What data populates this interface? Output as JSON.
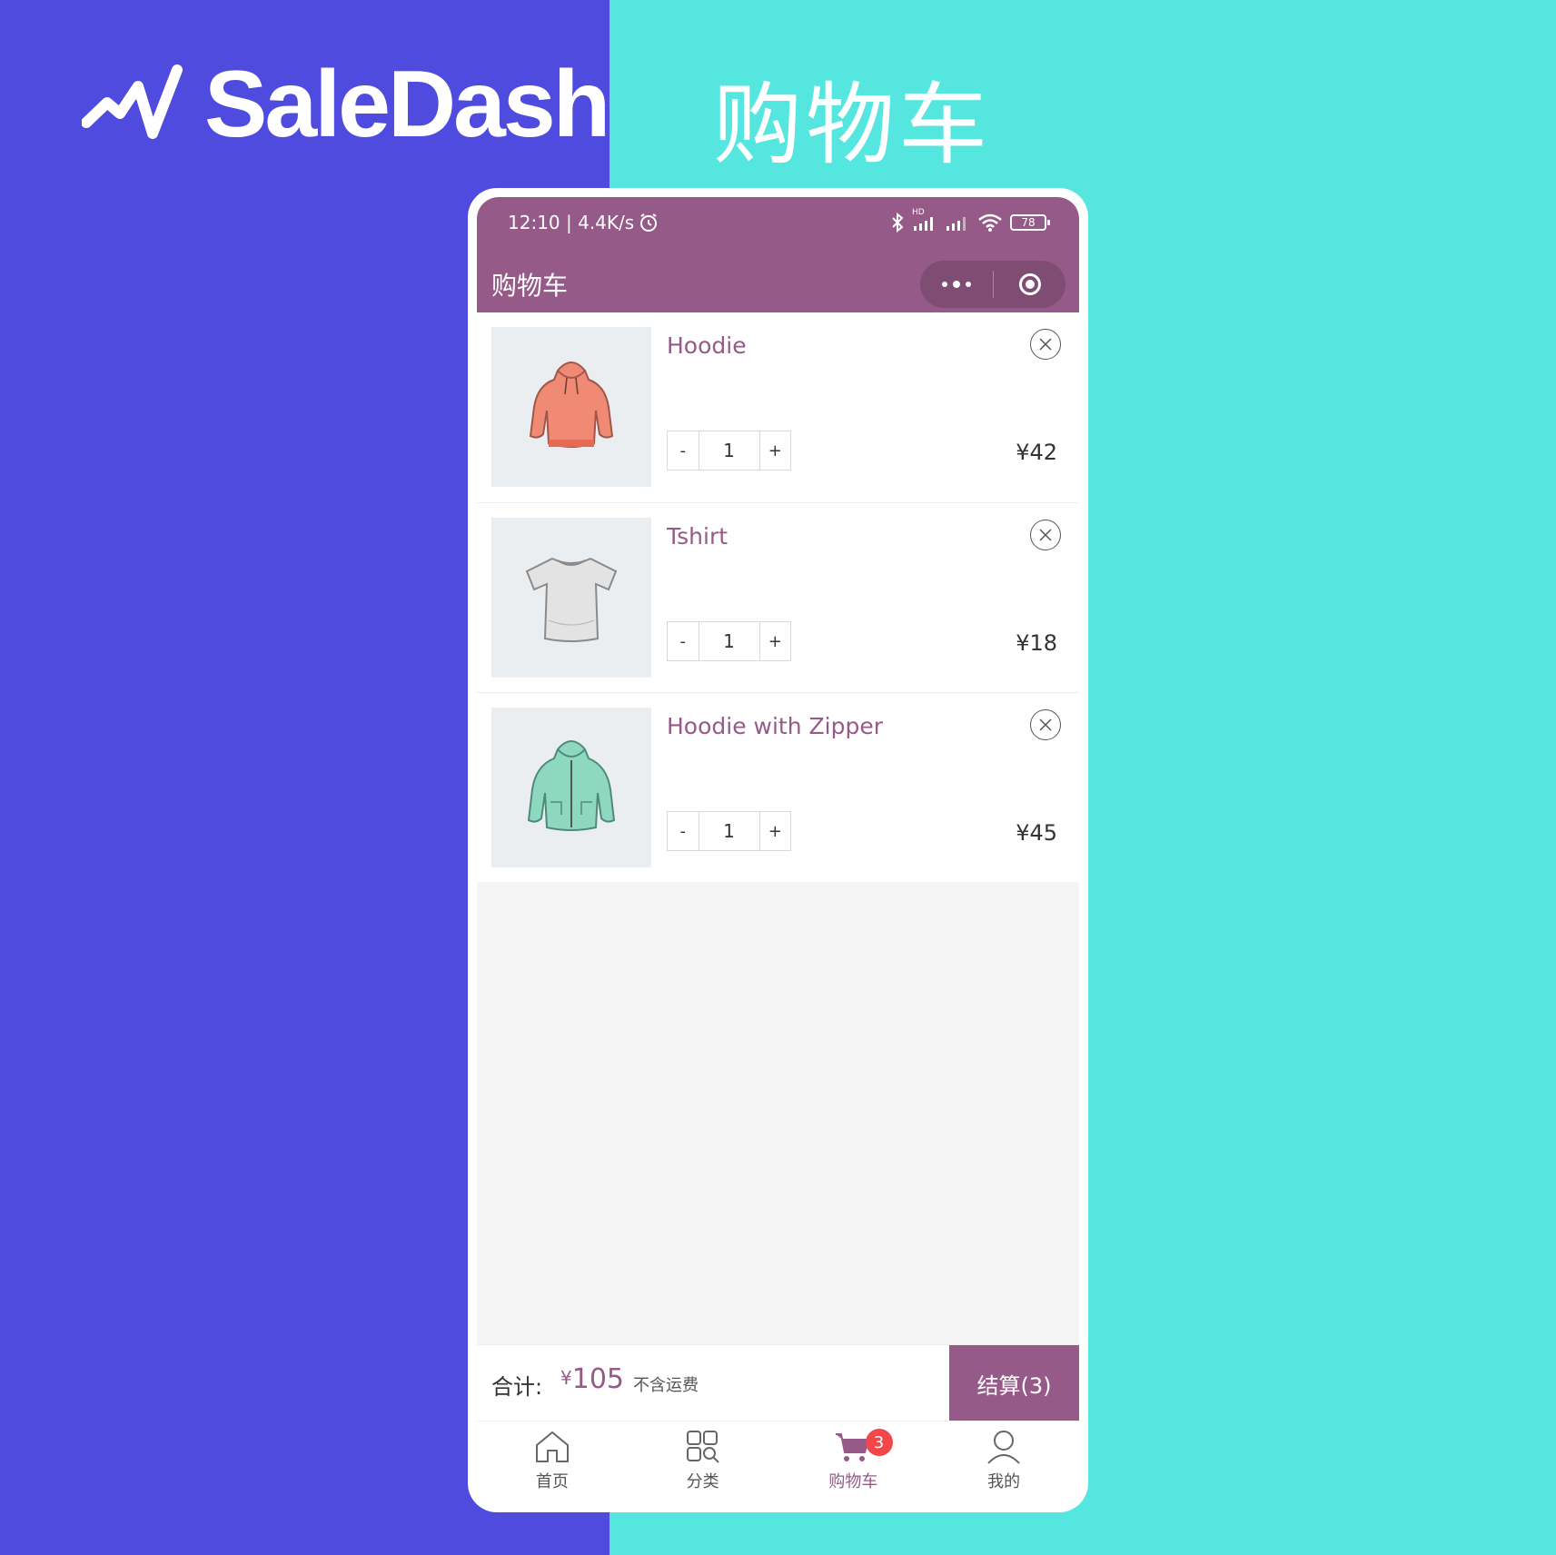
{
  "brand": {
    "name": "SaleDash"
  },
  "hero": {
    "title": "购物车"
  },
  "status_bar": {
    "time_speed": "12:10 | 4.4K/s",
    "hd_label": "HD",
    "battery": "78"
  },
  "navbar": {
    "title": "购物车"
  },
  "cart_items": [
    {
      "name": "Hoodie",
      "quantity": "1",
      "price": "¥42",
      "minus": "-",
      "plus": "+"
    },
    {
      "name": "Tshirt",
      "quantity": "1",
      "price": "¥18",
      "minus": "-",
      "plus": "+"
    },
    {
      "name": "Hoodie with Zipper",
      "quantity": "1",
      "price": "¥45",
      "minus": "-",
      "plus": "+"
    }
  ],
  "summary": {
    "label": "合计:",
    "currency": "¥",
    "amount": "105",
    "note": "不含运费",
    "checkout": "结算(3)"
  },
  "tabbar": {
    "items": [
      {
        "label": "首页"
      },
      {
        "label": "分类"
      },
      {
        "label": "购物车",
        "badge": "3"
      },
      {
        "label": "我的"
      }
    ]
  },
  "colors": {
    "left_bg": "#4e4bde",
    "right_bg": "#55e6e0",
    "accent": "#965a88",
    "badge": "#f0474b"
  }
}
